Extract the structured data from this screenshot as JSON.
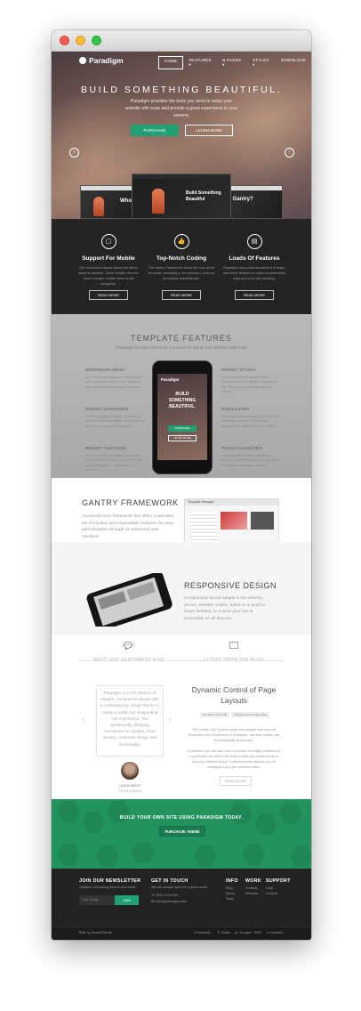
{
  "window": {
    "title": ""
  },
  "nav": {
    "logo": "Paradigm",
    "items": [
      {
        "label": "HOME",
        "active": true
      },
      {
        "label": "FEATURES ▾"
      },
      {
        "label": "B PAGES ▾"
      },
      {
        "label": "STYLES ▾"
      },
      {
        "label": "DOWNLOAD"
      }
    ]
  },
  "hero": {
    "title": "BUILD SOMETHING BEAUTIFUL.",
    "subtitle": "Paradigm provides the tools you need to setup your website with ease and provide a great experience to your viewers.",
    "purchase": "PURCHASE",
    "learn": "LEARN MORE",
    "prev": "‹",
    "next": "›",
    "shot_center": "Build Something Beautiful",
    "shot_left": "Who",
    "shot_right": "Is Gantry?"
  },
  "features": [
    {
      "icon": "▢",
      "title": "Support For Mobile",
      "desc": "The responsive layout allows the site to adapt to mobiles. These smaller devices have a unique mobile menu to aid navigation.",
      "btn": "READ MORE"
    },
    {
      "icon": "👍",
      "title": "Top-Notch Coding",
      "desc": "The Gantry Framework forms the core of the template, providing a rich selection, such as an intuitive administrator.",
      "btn": "READ MORE"
    },
    {
      "icon": "▤",
      "title": "Loads Of Features",
      "desc": "Paradigm has a vast assortment of major and minor features to make customization easy and your site standing.",
      "btn": "READ MORE"
    }
  ],
  "template": {
    "title": "TEMPLATE FEATURES",
    "subtitle": "Paradigm Provides The Tools You Need To Setup Your Website With Ease",
    "left": [
      {
        "h": "DROPDOWN MENU",
        "t": "A CSS based dropdown menu system with numerous options and features such as icons and multiple columns."
      },
      {
        "h": "WIDGET VARIATIONS",
        "t": "There are eight stylistic variations to provide individual widget styling as well as several structural variations."
      },
      {
        "h": "WIDGET POSITIONS",
        "t": "There are over 60 widget positions total, and they reset 6 by column with adjustable widths, globally or per override."
      }
    ],
    "right": [
      {
        "h": "PRESET STYLES",
        "t": "Choose from eight preset style variations with a highlight position for bar, link, accent, and background colors."
      },
      {
        "h": "ROKGALLERY",
        "t": "A versatile content display plugin with integrated styling for Paradigm, including the featured layout option."
      },
      {
        "h": "ROCKETLAUNCHER",
        "t": "A custom WordPress installation package that installs a near equivalent of the demo onto your server."
      }
    ],
    "phone_title": "Paradigm",
    "phone_text": "BUILD SOMETHING BEAUTIFUL.",
    "phone_btn1": "PURCHASE",
    "phone_btn2": "LEARN MORE"
  },
  "gantry": {
    "title": "GANTRY FRAMEWORK",
    "desc": "A powerful core framework that offers a standard set of intuitive and expandable features, for easy administration through an advanced user interface.",
    "shot_title": "Template Manager"
  },
  "responsive": {
    "title": "RESPONSIVE DESIGN",
    "desc": "A responsive layout adapts to the viewing device, whether mobile, tablet or a small or larger desktop, to ensure your site is accessible on all devices."
  },
  "testimonials": {
    "head": "WHAT OUR CUSTOMERS SAID",
    "quote": "Paradigm is a rich infusion of elegant, transparent visuals with a contemporary design theme to create a subtle but invigorating site experience. The dynamically changing transparent to opaque, fixed header, combines design and functionality.",
    "name": "LINDA SMITH",
    "role": "CEO of Nowhere",
    "prev": "‹",
    "next": "›"
  },
  "blog": {
    "head": "LATEST FROM THE BLOG",
    "title": "Dynamic Control of Page Layouts",
    "tags": [
      "Sat 10/12, 05:14 PM",
      "Published in Paradigm Blog"
    ],
    "text1": "The Gantry Grid System splits each widget row, such as Showcase into a maximum of 6 widgets, and their widths can be individually determined.",
    "text2": "In addition, you can also force a number of widget positions for a particular row, which will ensure blank grid positions as to suit your desired layout. Furthermore the layouts can be configured on a per-override basis.",
    "btn": "READ MORE"
  },
  "cta": {
    "title": "BUILD YOUR OWN SITE USING PARADIGM TODAY.",
    "btn": "PURCHASE THEME"
  },
  "footer": {
    "news_title": "JOIN OUR NEWSLETTER",
    "news_text": "Updates, upcoming themes and more!",
    "email_placeholder": "Your Email",
    "join": "JOIN",
    "touch_title": "GET IN TOUCH",
    "touch_text": "We are always open for a quick email.",
    "phone": "☏ 876-123-8789",
    "email": "✉ hello@paradigm.com",
    "info_title": "INFO",
    "info": [
      "Blog",
      "About",
      "Team"
    ],
    "work_title": "WORK",
    "work": [
      "Portfolio",
      "Services"
    ],
    "support_title": "SUPPORT",
    "support": [
      "Help",
      "Contact"
    ],
    "credit": "Built by RocketTheme",
    "social": [
      "f Facebook",
      "✕ Twitter",
      "g+ Google+",
      "RSS",
      "in LinkedIn"
    ]
  }
}
